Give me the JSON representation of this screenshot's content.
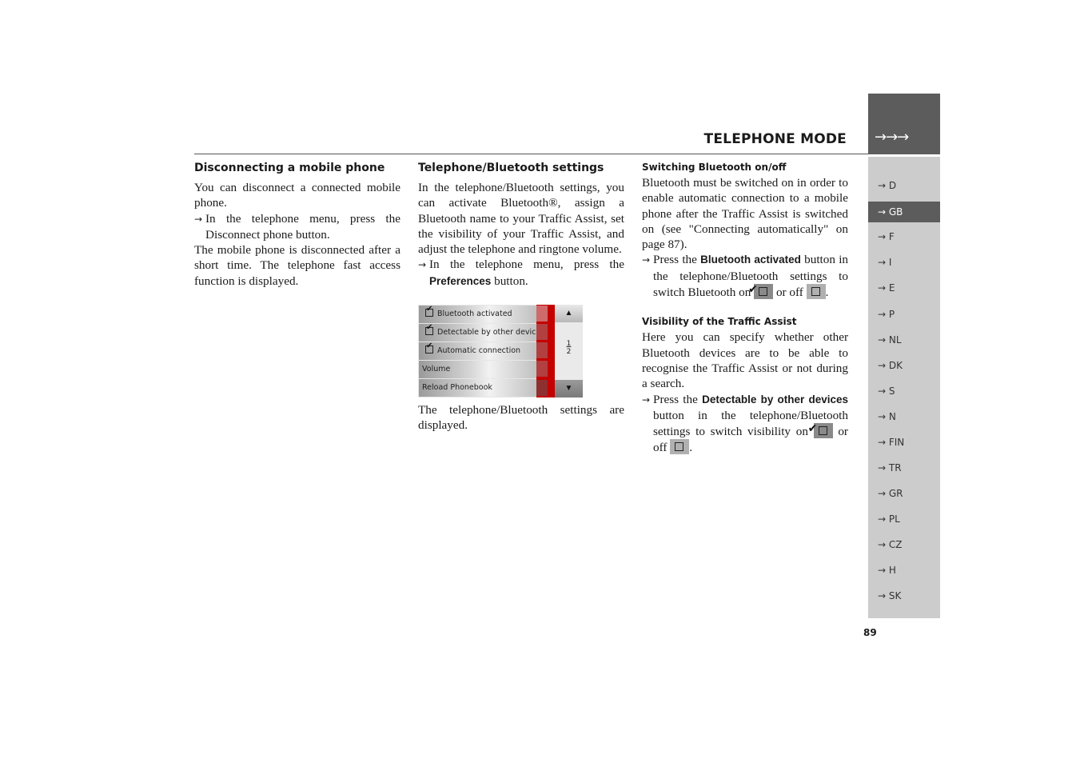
{
  "header": {
    "title": "TELEPHONE MODE",
    "tab_arrows": "→→→"
  },
  "sidebar": {
    "active": "GB",
    "items": [
      {
        "label": "→ D"
      },
      {
        "label": "→ GB"
      },
      {
        "label": "→ F"
      },
      {
        "label": "→ I"
      },
      {
        "label": "→ E"
      },
      {
        "label": "→ P"
      },
      {
        "label": "→ NL"
      },
      {
        "label": "→ DK"
      },
      {
        "label": "→ S"
      },
      {
        "label": "→ N"
      },
      {
        "label": "→ FIN"
      },
      {
        "label": "→ TR"
      },
      {
        "label": "→ GR"
      },
      {
        "label": "→ PL"
      },
      {
        "label": "→ CZ"
      },
      {
        "label": "→ H"
      },
      {
        "label": "→ SK"
      }
    ]
  },
  "page_number": "89",
  "col1": {
    "heading": "Disconnecting a mobile phone",
    "p1": "You can disconnect a connected mobile phone.",
    "step1": "In the telephone menu, press the Disconnect phone button.",
    "p2": "The mobile phone is disconnected after a short time. The telephone fast access function is displayed."
  },
  "col2": {
    "heading": "Telephone/Bluetooth settings",
    "p1": "In the telephone/Bluetooth settings, you can activate Bluetooth®, assign a Bluetooth name to your Traffic Assist, set the visibility of your Traffic Assist, and adjust the telephone and ringtone volume.",
    "step1_pre": "In the telephone menu, press the ",
    "step1_ui": "Preferences",
    "step1_post": " button.",
    "device": {
      "rows": [
        {
          "label": "Bluetooth activated",
          "checked": true
        },
        {
          "label": "Detectable by other devices",
          "checked": true
        },
        {
          "label": "Automatic connection",
          "checked": true
        },
        {
          "label": "Volume",
          "checked": null
        },
        {
          "label": "Reload Phonebook",
          "checked": null
        }
      ],
      "scroll_up": "▲",
      "scroll_down": "▼",
      "page_current": "1",
      "page_total": "2"
    },
    "p2": "The telephone/Bluetooth settings are displayed."
  },
  "col3": {
    "sub1": "Switching Bluetooth on/off",
    "p1": "Bluetooth must be switched on in order to enable automatic connection to a mobile phone after the Traffic Assist is switched on (see \"Connecting automatically\" on page 87).",
    "step1_pre": "Press the ",
    "step1_ui": "Bluetooth activated",
    "step1_mid": " button in the telephone/Bluetooth settings to switch Bluetooth on ",
    "step1_or": " or off ",
    "step1_end": ".",
    "sub2": "Visibility of the Traffic Assist",
    "p2": "Here you can specify whether other Bluetooth devices are to be able to recognise the Traffic Assist or not during a search.",
    "step2_pre": "Press the ",
    "step2_ui": "Detectable by other devices",
    "step2_mid": " button in the telephone/Bluetooth settings to switch visibility on ",
    "step2_or": " or off ",
    "step2_end": "."
  },
  "arrow_glyph": "→"
}
